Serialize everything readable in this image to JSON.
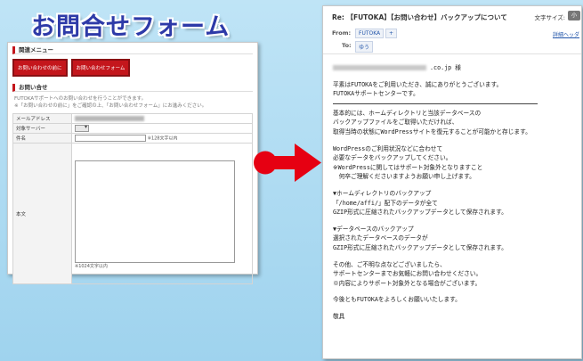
{
  "headline": "お問合せフォーム",
  "form_panel": {
    "related_menu_title": "関連メニュー",
    "related_links": [
      "お問い合わせの前に",
      "お問い合わせフォーム"
    ],
    "inquiry_title": "お問い合せ",
    "inquiry_desc_1": "FUTOKAサポートへのお問い合わせを行うことができます。",
    "inquiry_desc_2": "※「お問い合わせの前に」をご確認の上、「お問い合わせフォーム」にお進みください。",
    "fields": {
      "email_label": "メールアドレス",
      "server_label": "対象サーバー",
      "subject_label": "件名",
      "subject_note": "※128文字以内",
      "body_label": "本文",
      "body_note": "※1024文字以内"
    }
  },
  "email": {
    "subject": "Re: 【FUTOKA】【お問い合わせ】バックアップについて",
    "font_size_label": "文字サイズ:",
    "font_size_value": "小",
    "from_label": "From:",
    "from_value": "FUTOKA",
    "from_add": "+",
    "details_link": "詳細ヘッダ",
    "to_label": "To:",
    "to_value": "ゆう",
    "recipient_suffix": ".co.jp 様",
    "body": {
      "l1": "平素はFUTOKAをご利用いただき、誠にありがとうございます。",
      "l2": "FUTOKAサポートセンターです。",
      "l3": "基本的には、ホームディレクトリと当該データベースの",
      "l4": "バックアップファイルをご取得いただければ、",
      "l5": "取得当時の状態にWordPressサイトを復元することが可能かと存じます。",
      "l6": "WordPressのご利用状況などに合わせて",
      "l7": "必要なデータをバックアップしてください。",
      "l8": "※WordPressに関してはサポート対象外となりますこと",
      "l9": "　何卒ご理解くださいますようお願い申し上げます。",
      "l10": "▼ホームディレクトリのバックアップ",
      "l11": "「/home/affi/」配下のデータが全て",
      "l12": "GZIP形式に圧縮されたバックアップデータとして保存されます。",
      "l13": "▼データベースのバックアップ",
      "l14": "選択されたデータベースのデータが",
      "l15": "GZIP形式に圧縮されたバックアップデータとして保存されます。",
      "l16": "その他、ご不明な点などございましたら、",
      "l17": "サポートセンターまでお気軽にお問い合わせください。",
      "l18": "※内容によりサポート対象外となる場合がございます。",
      "l19": "今後ともFUTOKAをよろしくお願いいたします。",
      "l20": "敬具"
    }
  },
  "colors": {
    "background": "#aadbf2",
    "headline": "#2e3aa8",
    "accent_red": "#c4161c",
    "arrow_red": "#e60012"
  },
  "icons": [
    "right-arrow-icon",
    "select-dropdown-icon"
  ]
}
